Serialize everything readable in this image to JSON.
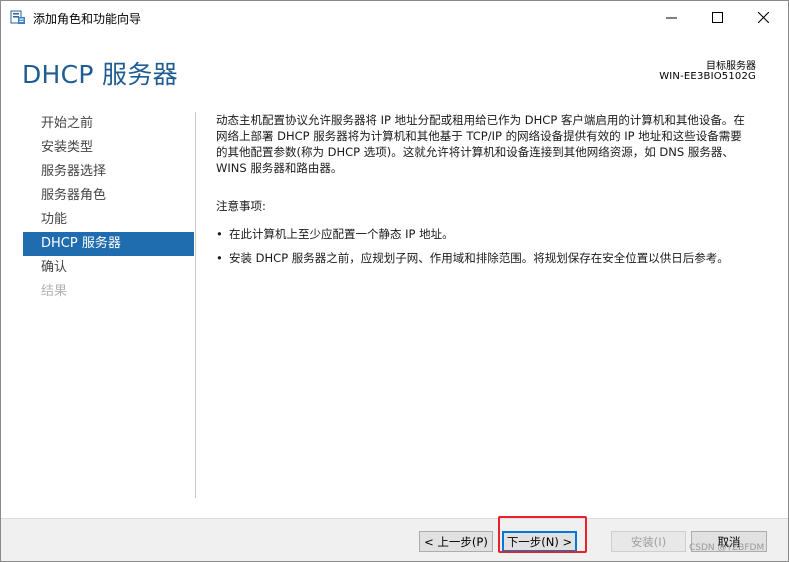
{
  "window": {
    "title": "添加角色和功能向导",
    "minimize_glyph": "—",
    "maximize_glyph": "☐",
    "close_glyph": "✕"
  },
  "header": {
    "page_title": "DHCP 服务器",
    "destination_label": "目标服务器",
    "destination_server": "WIN-EE3BIO5102G"
  },
  "nav": {
    "items": [
      {
        "label": "开始之前",
        "state": "normal"
      },
      {
        "label": "安装类型",
        "state": "normal"
      },
      {
        "label": "服务器选择",
        "state": "normal"
      },
      {
        "label": "服务器角色",
        "state": "normal"
      },
      {
        "label": "功能",
        "state": "normal"
      },
      {
        "label": "DHCP 服务器",
        "state": "active"
      },
      {
        "label": "确认",
        "state": "normal"
      },
      {
        "label": "结果",
        "state": "disabled"
      }
    ]
  },
  "content": {
    "intro_line1": "动态主机配置协议允许服务器将 IP 地址分配或租用给已作为 DHCP 客户端启用的计算机和其他设备。在",
    "intro_line2": "网络上部署 DHCP 服务器将为计算机和其他基于 TCP/IP 的网络设备提供有效的 IP 地址和这些设备需要",
    "intro_line3": "的其他配置参数(称为 DHCP 选项)。这就允许将计算机和设备连接到其他网络资源，如 DNS 服务器、",
    "intro_line4": "WINS 服务器和路由器。",
    "notes_heading": "注意事项:",
    "bullet": "•",
    "notes": [
      "在此计算机上至少应配置一个静态 IP 地址。",
      "安装 DHCP 服务器之前，应规划子网、作用域和排除范围。将规划保存在安全位置以供日后参考。"
    ]
  },
  "footer": {
    "prev_label": "< 上一步(P)",
    "next_label": "下一步(N) >",
    "install_label": "安装(I)",
    "cancel_label": "取消"
  },
  "watermark": "CSDN @YZBFDM",
  "colors": {
    "accent": "#1f6cae",
    "title_blue": "#1e5c93",
    "highlight_red": "#e8212b"
  }
}
